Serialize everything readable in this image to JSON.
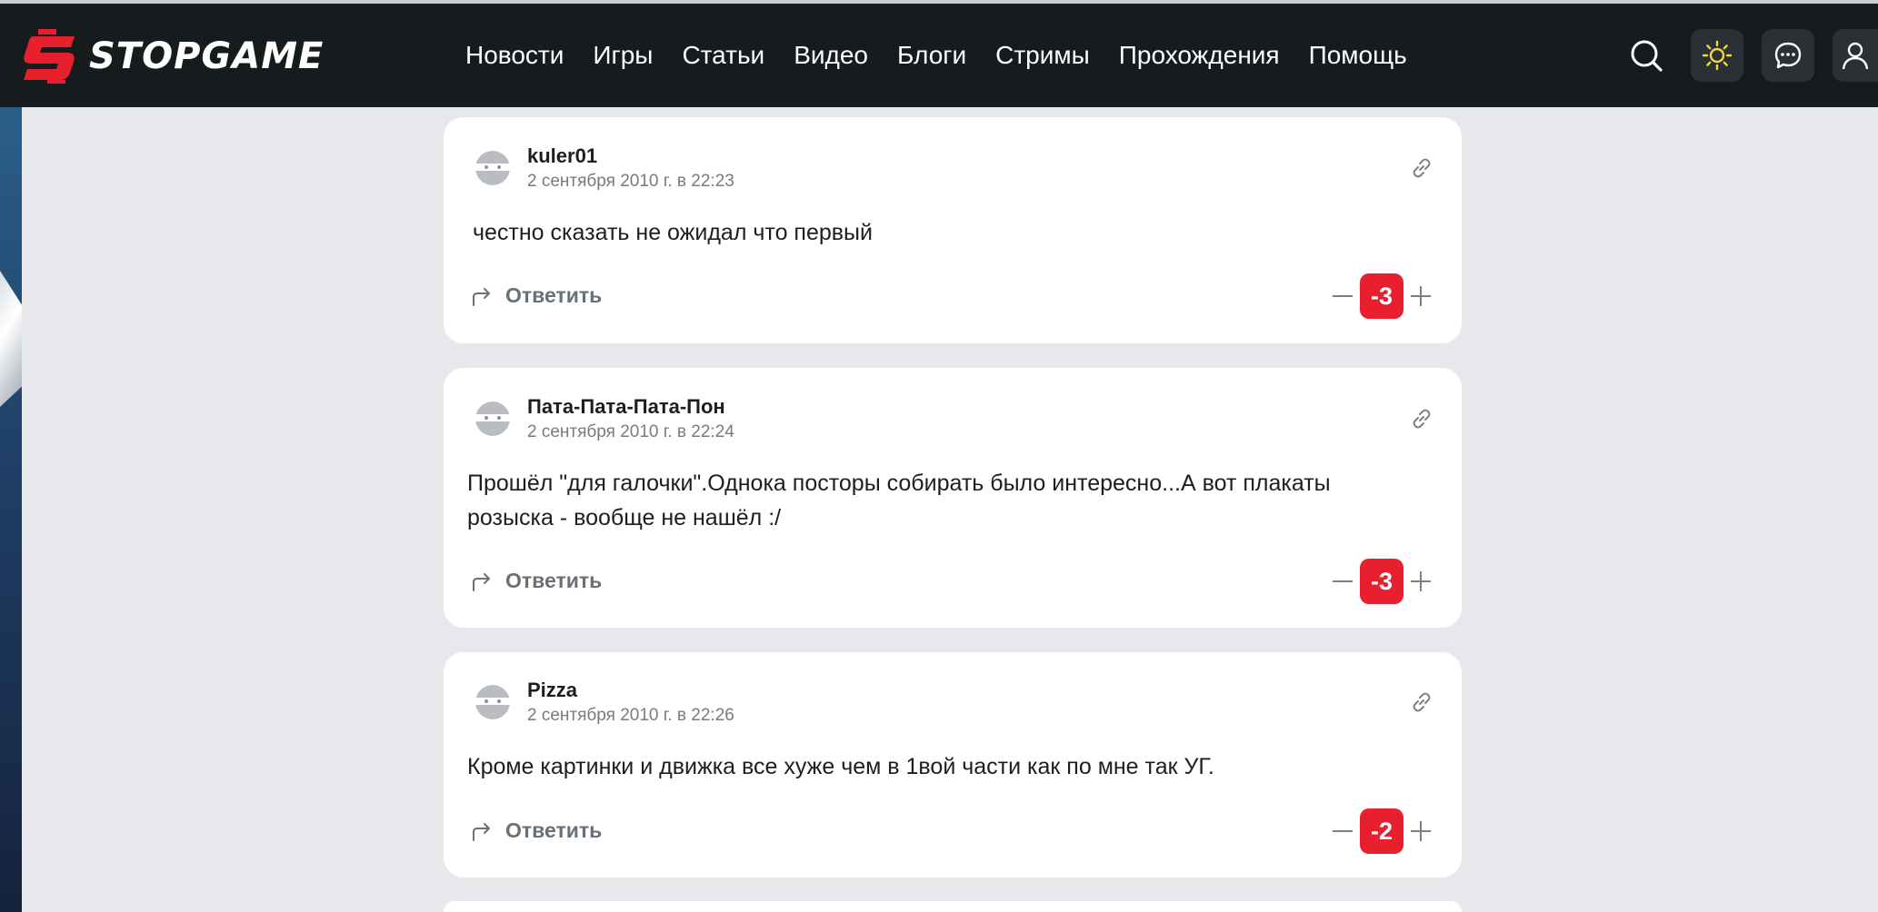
{
  "site": {
    "name": "STOPGAME",
    "brand_color": "#e8202e"
  },
  "nav": {
    "items": [
      {
        "label": "Новости"
      },
      {
        "label": "Игры"
      },
      {
        "label": "Статьи"
      },
      {
        "label": "Видео"
      },
      {
        "label": "Блоги"
      },
      {
        "label": "Стримы"
      },
      {
        "label": "Прохождения"
      },
      {
        "label": "Помощь"
      }
    ]
  },
  "header_icons": [
    "search-icon",
    "sun-icon",
    "chat-icon",
    "user-icon"
  ],
  "comments": [
    {
      "author": "kuler01",
      "date": "2 сентября 2010 г. в 22:23",
      "text": "честно сказать не ожидал что первый",
      "reply_label": "Ответить",
      "score": "-3"
    },
    {
      "author": "Пата-Пата-Пата-Пон",
      "date": "2 сентября 2010 г. в 22:24",
      "text": "Прошёл \"для галочки\".Однока посторы собирать было интересно...А вот плакаты розыска - вообще не нашёл :/",
      "reply_label": "Ответить",
      "score": "-3"
    },
    {
      "author": "Pizza",
      "date": "2 сентября 2010 г. в 22:26",
      "text": "Кроме картинки и движка все хуже чем в 1вой части как по мне так УГ.",
      "reply_label": "Ответить",
      "score": "-2"
    }
  ]
}
